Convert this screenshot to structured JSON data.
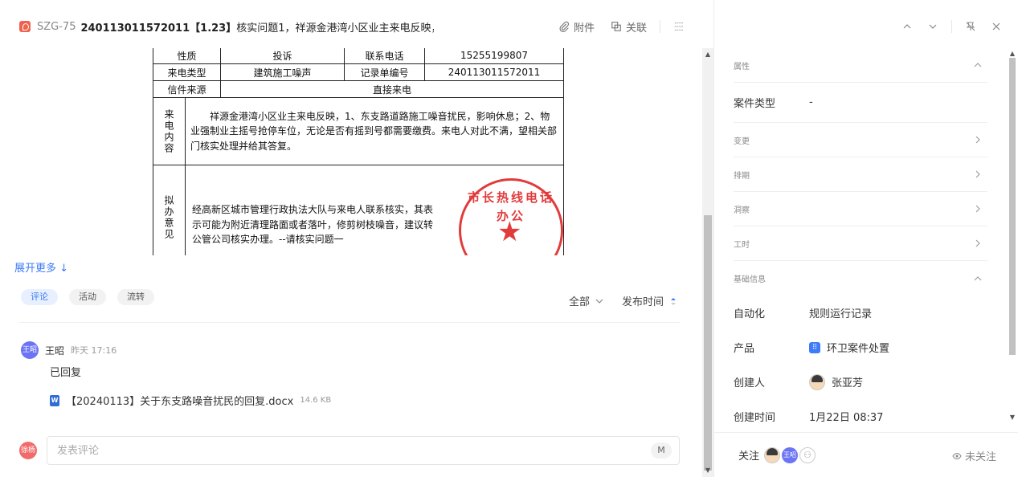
{
  "header": {
    "issue_key": "SZG-75",
    "title_bold": "240113011572011【1.23】",
    "title_rest": "核实问题1，祥源金港湾小区业主来电反映，1、…",
    "attachment_label": "附件",
    "link_label": "关联"
  },
  "document": {
    "row0": {
      "c1": "性质",
      "c2": "投诉",
      "c3": "联系电话",
      "c4": "15255199807"
    },
    "row1": {
      "c1": "来电类型",
      "c2": "建筑施工噪声",
      "c3": "记录单编号",
      "c4": "240113011572011"
    },
    "row2": {
      "c1": "信件来源",
      "c2": "直接来电"
    },
    "content_side": "来电内容",
    "content_text": "祥源金港湾小区业主来电反映，1、东支路道路施工噪音扰民，影响休息；2、物业强制业主摇号抢停车位，无论是否有摇到号都需要缴费。来电人对此不满，望相关部门核实处理并给其答复。",
    "opinion_side": "拟办意见",
    "opinion_text": "经高新区城市管理行政执法大队与来电人联系核实，其表示可能为附近清理路面或者落叶，修剪树枝噪音，建议转公管公司核实办理。--请核实问题一",
    "seal_text": "市长热线电话办公"
  },
  "expand_more": "展开更多 ↓",
  "tabs": [
    "评论",
    "活动",
    "流转"
  ],
  "filters": {
    "scope": "全部",
    "sort": "发布时间"
  },
  "comment": {
    "avatar": "王昭",
    "author": "王昭",
    "time": "昨天 17:16",
    "body": "已回复",
    "attachment_name": "【20240113】关于东支路噪音扰民的回复.docx",
    "attachment_size": "14.6 KB",
    "attachment_icon": "W"
  },
  "comment_input": {
    "avatar": "徐杨",
    "placeholder": "发表评论",
    "mention_button": "M"
  },
  "properties": {
    "section_attrs": "属性",
    "case_type_label": "案件类型",
    "case_type_value": "-",
    "section_change": "变更",
    "section_schedule": "排期",
    "section_insight": "洞察",
    "section_worktime": "工时",
    "section_basic": "基础信息",
    "automation_label": "自动化",
    "automation_value": "规则运行记录",
    "product_label": "产品",
    "product_value": "环卫案件处置",
    "creator_label": "创建人",
    "creator_value": "张亚芳",
    "created_label": "创建时间",
    "created_value": "1月22日 08:37"
  },
  "follow": {
    "label": "关注",
    "avatar2": "王昭",
    "unfollow": "未关注"
  },
  "colors": {
    "accent": "#3d7bf7",
    "issue_icon": "#f0624d",
    "avatar_blue": "#6b74f5",
    "avatar_red": "#f26b6b"
  }
}
